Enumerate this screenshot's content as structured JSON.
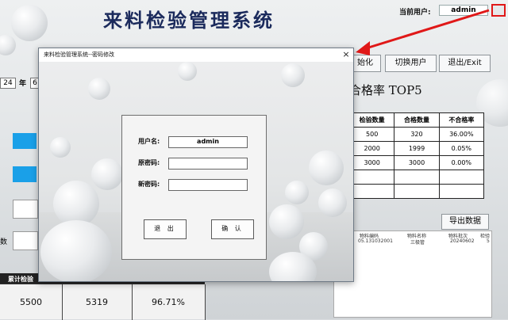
{
  "app": {
    "title": "来料检验管理系统",
    "current_user_label": "当前用户:",
    "current_user": "admin",
    "buttons": {
      "init": "始化",
      "switch_user": "切换用户",
      "exit": "退出/Exit"
    },
    "year_value": "24",
    "year_label": "年",
    "month_value": "6",
    "left_label": "数"
  },
  "top5": {
    "title": "合格率 TOP5",
    "columns": [
      "检验数量",
      "合格数量",
      "不合格率"
    ],
    "rows": [
      [
        "500",
        "320",
        "36.00%"
      ],
      [
        "2000",
        "1999",
        "0.05%"
      ],
      [
        "3000",
        "3000",
        "0.00%"
      ],
      [
        "",
        "",
        ""
      ],
      [
        "",
        "",
        ""
      ]
    ]
  },
  "export": {
    "button": "导出数据",
    "columns": [
      "物料编码",
      "物料名称",
      "物料批次",
      "检验"
    ],
    "row": [
      "05.131032001",
      "三极管",
      "20240602",
      "5"
    ]
  },
  "stats": {
    "header": "累计检验",
    "values": [
      "5500",
      "5319",
      "96.71%"
    ]
  },
  "dialog": {
    "title": "来料检验管理系统--密码修改",
    "close": "×",
    "username_label": "用户名:",
    "username_value": "admin",
    "old_password_label": "原密码:",
    "new_password_label": "新密码:",
    "cancel_button": "退 出",
    "confirm_button": "确 认"
  },
  "colors": {
    "accent": "#1aa0e8",
    "highlight": "#e01818",
    "title": "#1b2a5c"
  }
}
